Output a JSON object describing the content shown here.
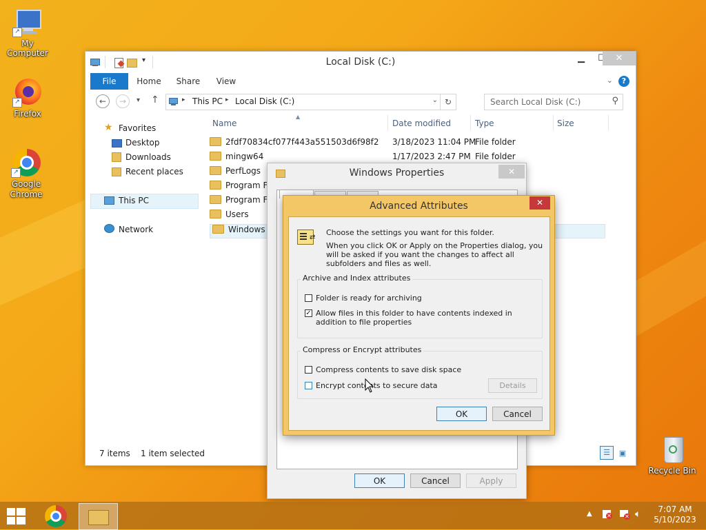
{
  "desktop": {
    "icons": [
      {
        "label": "My Computer"
      },
      {
        "label": "Firefox"
      },
      {
        "label": "Google Chrome"
      },
      {
        "label": "Recycle Bin"
      }
    ]
  },
  "explorer": {
    "title": "Local Disk (C:)",
    "ribbon_tabs": [
      "File",
      "Home",
      "Share",
      "View"
    ],
    "breadcrumb": [
      "This PC",
      "Local Disk (C:)"
    ],
    "search_placeholder": "Search Local Disk (C:)",
    "nav": {
      "favorites": "Favorites",
      "desktop": "Desktop",
      "downloads": "Downloads",
      "recent": "Recent places",
      "this_pc": "This PC",
      "network": "Network"
    },
    "columns": {
      "name": "Name",
      "date": "Date modified",
      "type": "Type",
      "size": "Size"
    },
    "files": [
      {
        "name": "2fdf70834cf077f443a551503d6f98f2",
        "date": "3/18/2023 11:04 PM",
        "type": "File folder"
      },
      {
        "name": "mingw64",
        "date": "1/17/2023 2:47 PM",
        "type": "File folder"
      },
      {
        "name": "PerfLogs",
        "date": "",
        "type": ""
      },
      {
        "name": "Program Fi",
        "date": "",
        "type": ""
      },
      {
        "name": "Program Fi",
        "date": "",
        "type": ""
      },
      {
        "name": "Users",
        "date": "",
        "type": ""
      },
      {
        "name": "Windows",
        "date": "",
        "type": ""
      }
    ],
    "status": {
      "items": "7 items",
      "selected": "1 item selected"
    }
  },
  "properties": {
    "title": "Windows Properties",
    "ok": "OK",
    "cancel": "Cancel",
    "apply": "Apply"
  },
  "advanced": {
    "title": "Advanced Attributes",
    "intro": "Choose the settings you want for this folder.",
    "note": "When you click OK or Apply on the Properties dialog, you will be asked if you want the changes to affect all subfolders and files as well.",
    "archive_group": "Archive and Index attributes",
    "archive_label": "Folder is ready for archiving",
    "archive_checked": false,
    "index_label": "Allow files in this folder to have contents indexed in addition to file properties",
    "index_checked": true,
    "compress_group": "Compress or Encrypt attributes",
    "compress_label": "Compress contents to save disk space",
    "compress_checked": false,
    "encrypt_label": "Encrypt contents to secure data",
    "encrypt_checked": false,
    "details": "Details",
    "ok": "OK",
    "cancel": "Cancel"
  },
  "taskbar": {
    "time": "7:07 AM",
    "date": "5/10/2023"
  },
  "colors": {
    "accent": "#1979ca",
    "dialog_frame": "#f4c766",
    "close_red": "#c7383a"
  }
}
